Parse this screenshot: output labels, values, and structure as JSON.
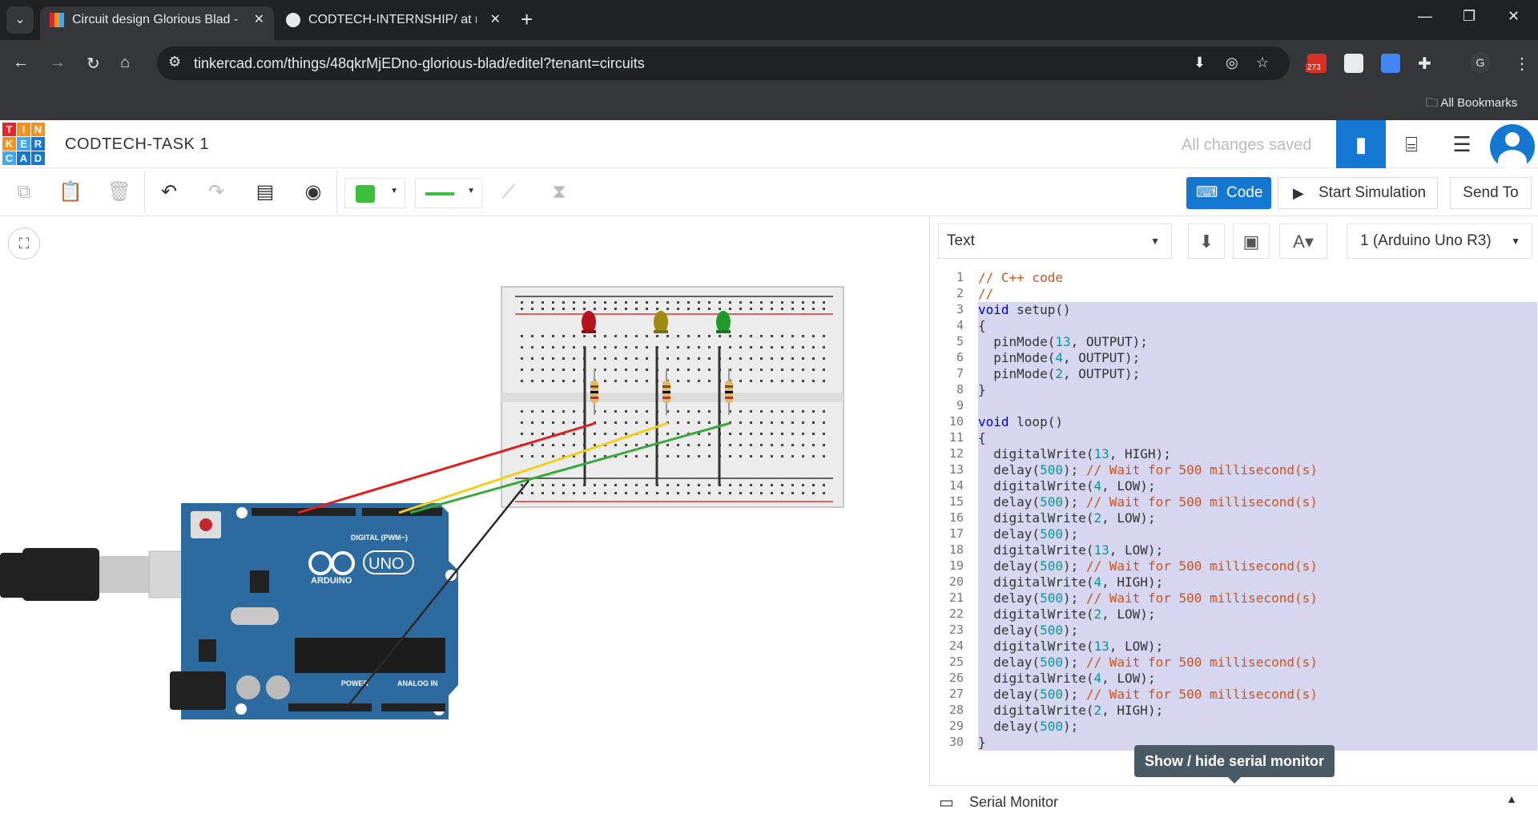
{
  "browser": {
    "tabs": [
      {
        "title": "Circuit design Glorious Blad - Ti",
        "active": true
      },
      {
        "title": "CODTECH-INTERNSHIP/ at mai",
        "active": false
      }
    ],
    "url": "tinkercad.com/things/48qkrMjEDno-glorious-blad/editel?tenant=circuits",
    "extension_badge": "273",
    "profile_initial": "G",
    "bookmarks_label": "All Bookmarks"
  },
  "app": {
    "logo_letters": [
      "T",
      "I",
      "N",
      "K",
      "E",
      "R",
      "C",
      "A",
      "D"
    ],
    "project_title": "CODTECH-TASK 1",
    "save_status": "All changes saved"
  },
  "toolbar": {
    "code_label": "Code",
    "start_simulation_label": "Start Simulation",
    "send_to_label": "Send To",
    "color_swatch": "#3cc03c"
  },
  "code_panel": {
    "mode": "Text",
    "device": "1 (Arduino Uno R3)",
    "lines": [
      "// C++ code",
      "//",
      "void setup()",
      "{",
      "  pinMode(13, OUTPUT);",
      "  pinMode(4, OUTPUT);",
      "  pinMode(2, OUTPUT);",
      "}",
      "",
      "void loop()",
      "{",
      "  digitalWrite(13, HIGH);",
      "  delay(500); // Wait for 500 millisecond(s)",
      "  digitalWrite(4, LOW);",
      "  delay(500); // Wait for 500 millisecond(s)",
      "  digitalWrite(2, LOW);",
      "  delay(500);",
      "  digitalWrite(13, LOW);",
      "  delay(500); // Wait for 500 millisecond(s)",
      "  digitalWrite(4, HIGH);",
      "  delay(500); // Wait for 500 millisecond(s)",
      "  digitalWrite(2, LOW);",
      "  delay(500);",
      "  digitalWrite(13, LOW);",
      "  delay(500); // Wait for 500 millisecond(s)",
      "  digitalWrite(4, LOW);",
      "  delay(500); // Wait for 500 millisecond(s)",
      "  digitalWrite(2, HIGH);",
      "  delay(500);",
      "}"
    ],
    "tooltip": "Show / hide serial monitor",
    "serial_monitor_label": "Serial Monitor"
  },
  "circuit": {
    "board_labels": {
      "uno": "UNO",
      "arduino": "ARDUINO",
      "digital": "DIGITAL (PWM~)",
      "power": "POWER",
      "analog": "ANALOG IN"
    },
    "led_colors": [
      "#b3131a",
      "#a08a14",
      "#1e9a2a"
    ],
    "wire_colors": [
      "#e02020",
      "#f2d01a",
      "#3aa83a",
      "#2a2a2a"
    ]
  }
}
